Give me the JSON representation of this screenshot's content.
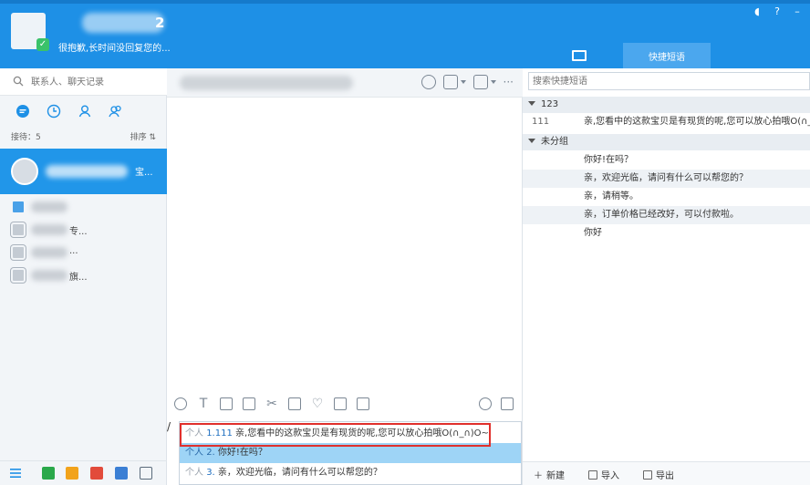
{
  "header": {
    "user_name_suffix": "2",
    "status_text": "很抱歉,长时间没回复您的...",
    "tabs": [
      {
        "label": "",
        "icon": "card-icon"
      },
      {
        "label": "快捷短语",
        "active": true
      }
    ]
  },
  "sidebar": {
    "search_placeholder": "联系人、聊天记录",
    "stats_left": "接待：5",
    "stats_right": "排序 ⇅",
    "active_contact_text": "宝...",
    "contacts": [
      {
        "text": ""
      },
      {
        "text": "专..."
      },
      {
        "text": "..."
      },
      {
        "text": "旗..."
      }
    ]
  },
  "chat": {
    "more_label": "···",
    "input_prefix": "/"
  },
  "suggestions": [
    {
      "prefix": "个人",
      "num": "1.",
      "code": "111",
      "text": "亲,您看中的这款宝贝是有现货的呢,您可以放心拍哦O(∩_∩)O~"
    },
    {
      "prefix": "个人",
      "num": "2.",
      "code": "",
      "text": "你好!在吗？"
    },
    {
      "prefix": "个人",
      "num": "3.",
      "code": "",
      "text": "亲，欢迎光临，请问有什么可以帮您的？"
    }
  ],
  "phrases": {
    "search_placeholder": "搜索快捷短语",
    "groups": [
      {
        "name": "123",
        "items": [
          {
            "code": "111",
            "text": "亲,您看中的这款宝贝是有现货的呢,您可以放心拍哦O(∩_∩)O~"
          }
        ]
      },
      {
        "name": "未分组",
        "items": [
          {
            "code": "",
            "text": "你好!在吗？"
          },
          {
            "code": "",
            "text": "亲，欢迎光临，请问有什么可以帮您的？"
          },
          {
            "code": "",
            "text": "亲，请稍等。"
          },
          {
            "code": "",
            "text": "亲，订单价格已经改好，可以付款啦。"
          },
          {
            "code": "",
            "text": "你好"
          }
        ]
      }
    ],
    "footer": {
      "new_label": "新建",
      "import_label": "导入",
      "export_label": "导出"
    }
  },
  "colors": {
    "primary": "#1e90e6",
    "selected_row": "#9ed4f6",
    "highlight_border": "#e0302c"
  }
}
